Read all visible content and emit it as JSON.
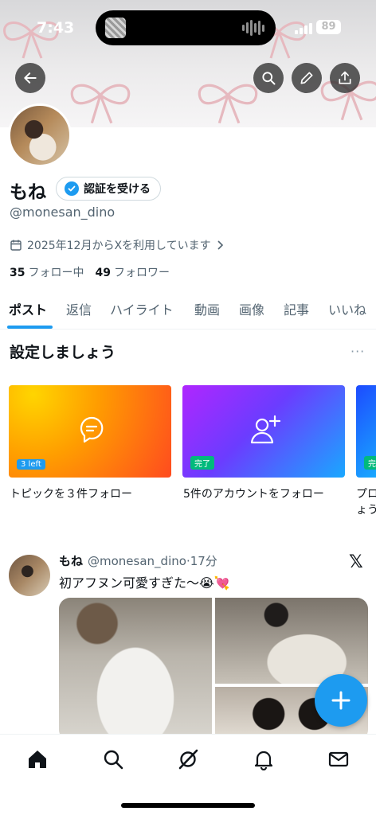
{
  "status_bar": {
    "time": "7:43",
    "battery": "89"
  },
  "profile": {
    "name": "もね",
    "verify_label": "認証を受ける",
    "handle": "@monesan_dino",
    "joined": "2025年12月からXを利用しています",
    "following_count": "35",
    "following_label": "フォロー中",
    "followers_count": "49",
    "followers_label": "フォロワー"
  },
  "tabs": [
    {
      "label": "ポスト",
      "active": true
    },
    {
      "label": "返信"
    },
    {
      "label": "ハイライト"
    },
    {
      "label": "動画"
    },
    {
      "label": "画像"
    },
    {
      "label": "記事"
    },
    {
      "label": "いいね"
    }
  ],
  "setup": {
    "title": "設定しましょう",
    "cards": [
      {
        "label": "トピックを３件フォロー",
        "tag": "3 left"
      },
      {
        "label": "5件のアカウントをフォロー",
        "tag": "完了"
      },
      {
        "label": "プロ",
        "label2": "ょう",
        "tag": "完"
      }
    ]
  },
  "post": {
    "name": "もね",
    "handle": "@monesan_dino",
    "time": "·17分",
    "text": "初アフヌン可愛すぎた〜😭💘"
  },
  "icons": {
    "back": "back-arrow-icon",
    "search": "search-icon",
    "edit": "pencil-icon",
    "share": "share-icon",
    "verified": "verified-badge-icon",
    "calendar": "calendar-icon",
    "x_logo": "x-logo-icon",
    "compose": "plus-icon",
    "nav": [
      "home-icon",
      "search-icon",
      "grok-icon",
      "bell-icon",
      "mail-icon"
    ]
  },
  "colors": {
    "accent": "#1d9bf0",
    "text_secondary": "#536471"
  }
}
